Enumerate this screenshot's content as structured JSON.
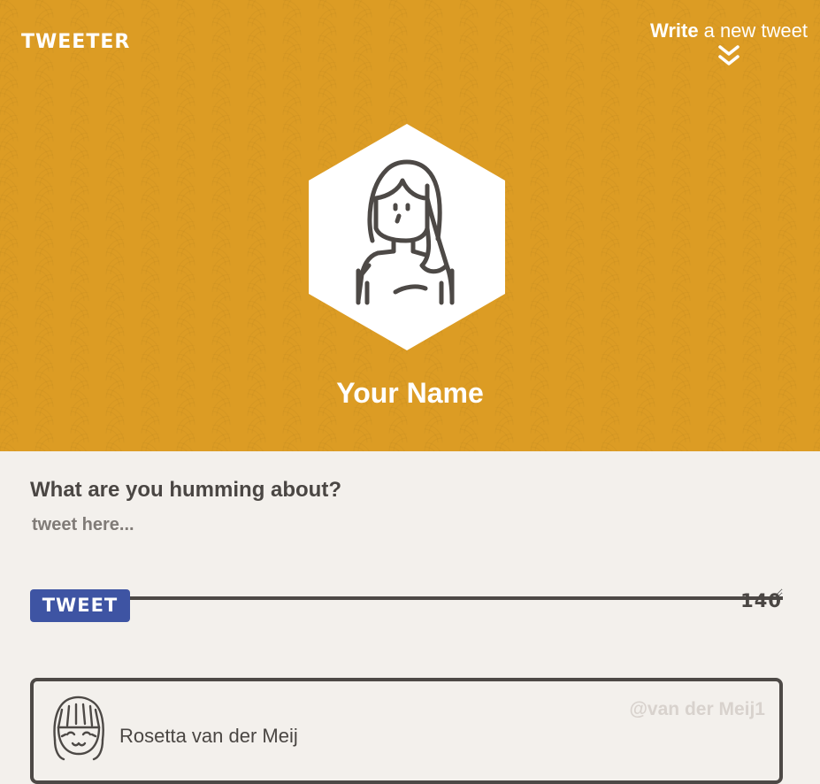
{
  "app": {
    "logo": "TWEETER"
  },
  "nav": {
    "write_strong": "Write",
    "write_light": "a new tweet",
    "chevron_icon": "double-chevron-down-icon"
  },
  "profile": {
    "avatar_icon": "user-avatar-hexagon-icon",
    "name": "Your Name"
  },
  "compose": {
    "label": "What are you humming about?",
    "placeholder": "tweet here...",
    "value": "",
    "button_label": "TWEET",
    "char_count": "140"
  },
  "feed": {
    "tweets": [
      {
        "avatar_icon": "user-avatar-icon",
        "name": "Rosetta van der Meij",
        "handle": "@van der Meij1"
      }
    ]
  },
  "colors": {
    "header_bg": "#dc9c24",
    "page_bg": "#f3f0ec",
    "button_bg": "#3e54a3",
    "text_dark": "#4a4643",
    "handle_text": "#d8d2cd"
  }
}
